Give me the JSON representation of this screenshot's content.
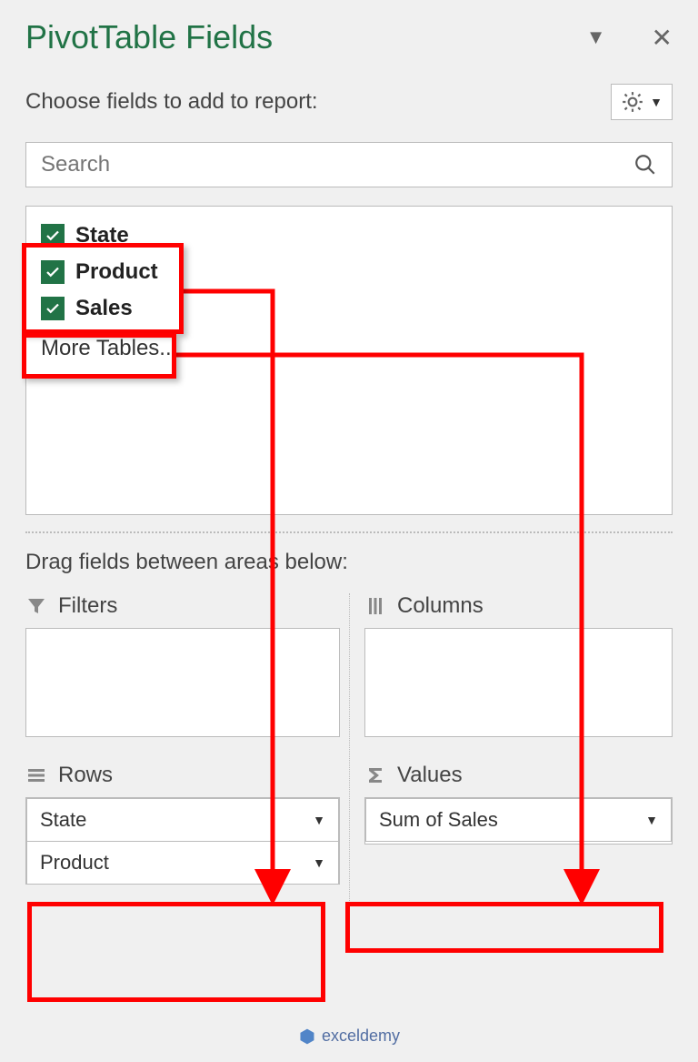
{
  "header": {
    "title": "PivotTable Fields",
    "subtitle": "Choose fields to add to report:"
  },
  "search": {
    "placeholder": "Search"
  },
  "fields": {
    "items": [
      "State",
      "Product",
      "Sales"
    ],
    "more_label": "More Tables..."
  },
  "drag": {
    "label": "Drag fields between areas below:"
  },
  "areas": {
    "filters": {
      "title": "Filters",
      "items": []
    },
    "columns": {
      "title": "Columns",
      "items": []
    },
    "rows": {
      "title": "Rows",
      "items": [
        "State",
        "Product"
      ]
    },
    "values": {
      "title": "Values",
      "items": [
        "Sum of Sales"
      ]
    }
  },
  "watermark": {
    "text": "exceldemy"
  }
}
